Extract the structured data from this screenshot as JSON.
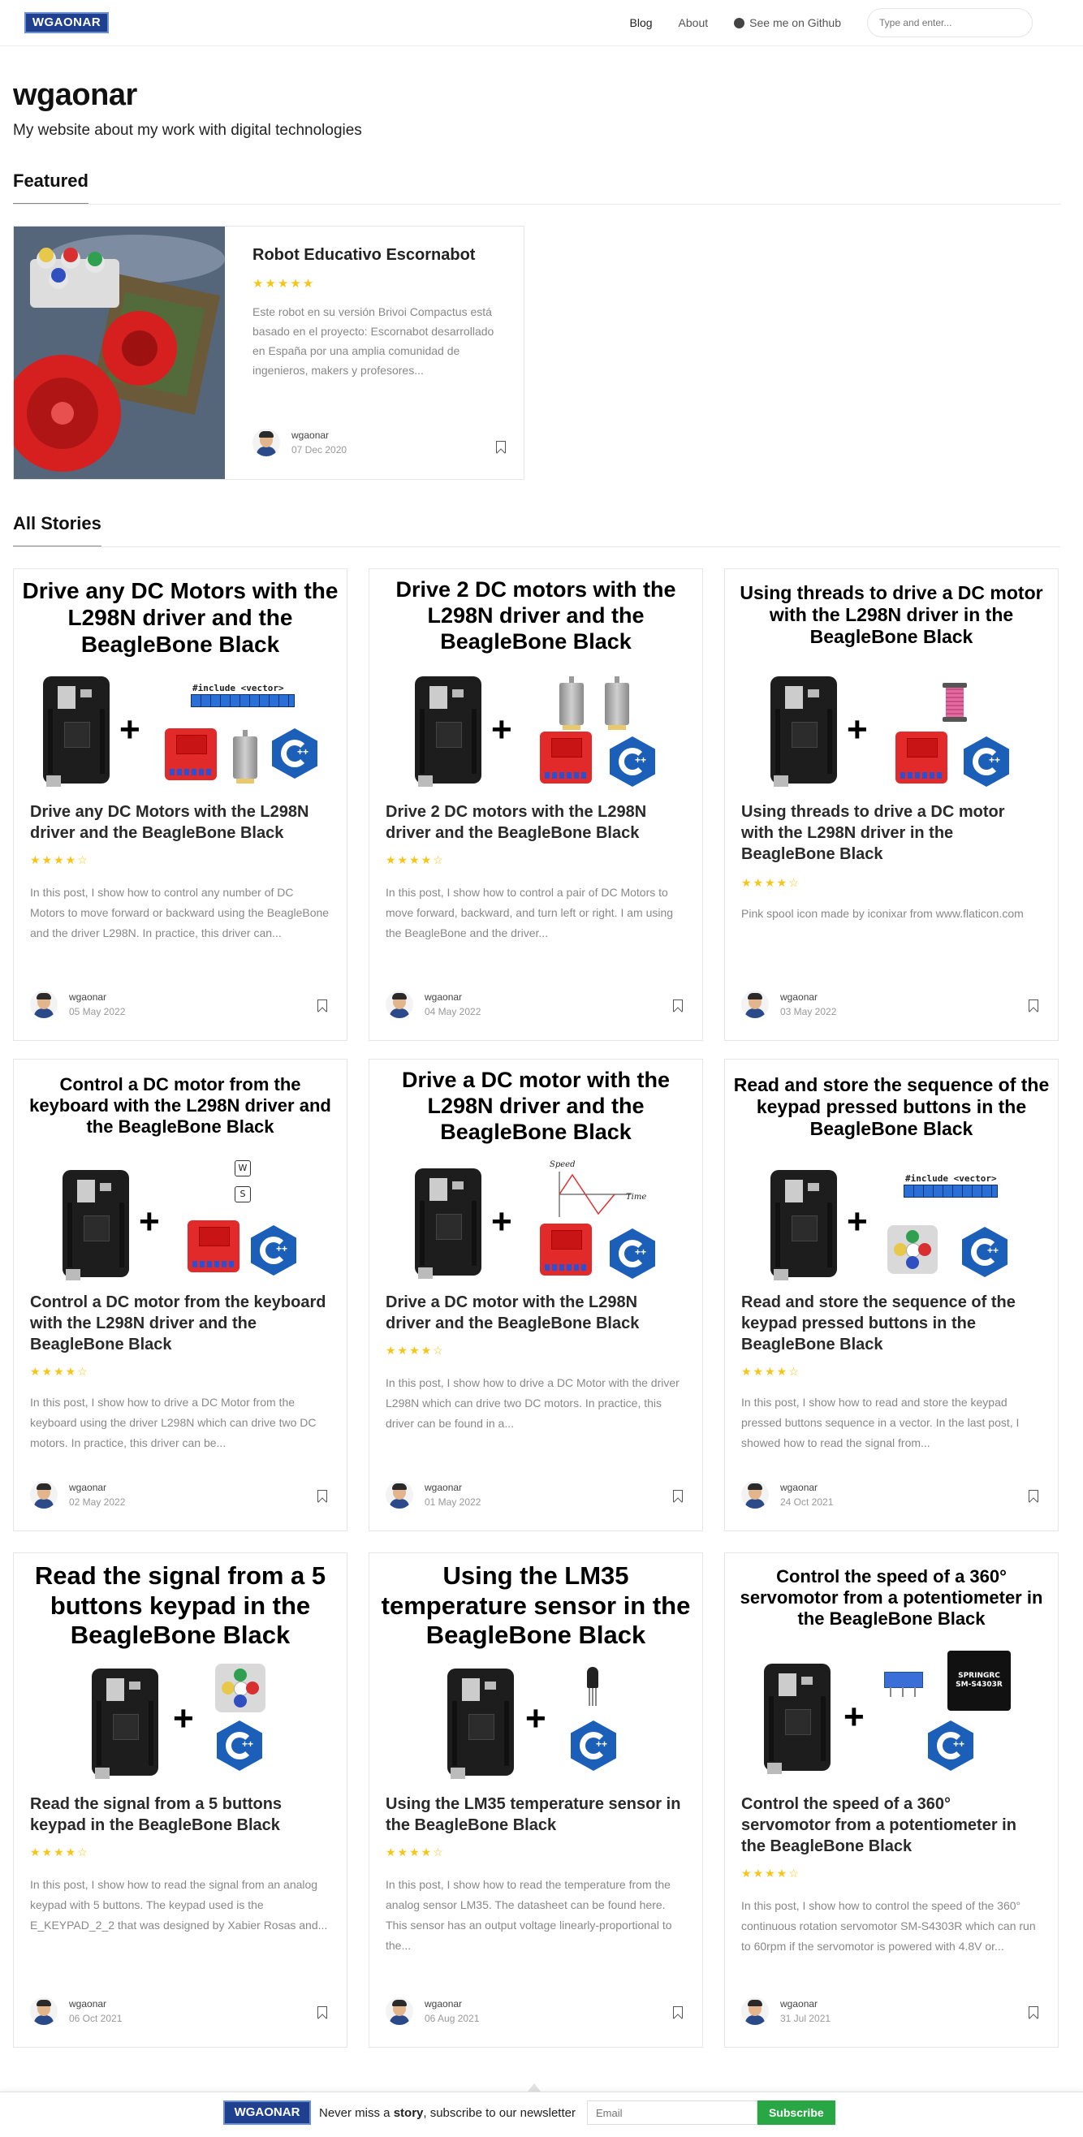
{
  "nav": {
    "logo": "WGAONAR",
    "blog": "Blog",
    "about": "About",
    "github": "See me on Github",
    "search_placeholder": "Type and enter..."
  },
  "header": {
    "title": "wgaonar",
    "description": "My website about my work with digital technologies"
  },
  "featured": {
    "heading": "Featured",
    "title": "Robot Educativo Escornabot",
    "stars": "★★★★★",
    "excerpt": "Este robot en su versión Brivoi Compactus está basado en el proyecto: Escornabot desarrollado en España por una amplia comunidad de ingenieros, makers y profesores...",
    "author": "wgaonar",
    "date": "07 Dec 2020"
  },
  "stories": {
    "heading": "All Stories",
    "cards": [
      {
        "thumb_title": "Drive any DC Motors with the L298N driver and the BeagleBone Black",
        "title": "Drive any DC Motors with the L298N driver and the BeagleBone Black",
        "stars": "★★★★☆",
        "excerpt": "In this post, I show how to control any number of DC Motors to move forward or backward using the BeagleBone and the driver L298N. In practice, this driver can...",
        "author": "wgaonar",
        "date": "05 May 2022",
        "vector_code": "#include <vector>"
      },
      {
        "thumb_title": "Drive 2 DC motors with the L298N driver and the BeagleBone Black",
        "title": "Drive 2 DC motors with the L298N driver and the BeagleBone Black",
        "stars": "★★★★☆",
        "excerpt": "In this post, I show how to control a pair of DC Motors to move forward, backward, and turn left or right. I am using the BeagleBone and the driver...",
        "author": "wgaonar",
        "date": "04 May 2022"
      },
      {
        "thumb_title": "Using threads to drive a DC motor with the L298N driver in the BeagleBone Black",
        "title": "Using threads to drive a DC motor with the L298N driver in the BeagleBone Black",
        "stars": "★★★★☆",
        "excerpt": "Pink spool icon made by iconixar from www.flaticon.com",
        "author": "wgaonar",
        "date": "03 May 2022"
      },
      {
        "thumb_title": "Control a DC motor from the keyboard with the L298N driver and the BeagleBone Black",
        "title": "Control a DC motor from the keyboard with the L298N driver and the BeagleBone Black",
        "stars": "★★★★☆",
        "excerpt": "In this post, I show how to drive a DC Motor from the keyboard using the driver L298N which can drive two DC motors. In practice, this driver can be...",
        "author": "wgaonar",
        "date": "02 May 2022",
        "key_w": "W",
        "key_s": "S"
      },
      {
        "thumb_title": "Drive a DC motor with the L298N driver and the BeagleBone Black",
        "title": "Drive a DC motor with the L298N driver and the BeagleBone Black",
        "stars": "★★★★☆",
        "excerpt": "In this post, I show how to drive a DC Motor with the driver L298N which can drive two DC motors. In practice, this driver can be found in a...",
        "author": "wgaonar",
        "date": "01 May 2022",
        "speed_label": "Speed",
        "time_label": "Time"
      },
      {
        "thumb_title": "Read and store the sequence of the keypad pressed buttons in the BeagleBone Black",
        "title": "Read and store the sequence of the keypad pressed buttons in the BeagleBone Black",
        "stars": "★★★★☆",
        "excerpt": "In this post, I show how to read and store the keypad pressed buttons sequence in a vector. In the last post, I showed how to read the signal from...",
        "author": "wgaonar",
        "date": "24 Oct 2021",
        "vector_code": "#include <vector>"
      },
      {
        "thumb_title": "Read the signal from a 5 buttons keypad in the BeagleBone Black",
        "title": "Read the signal from a 5 buttons keypad in the BeagleBone Black",
        "stars": "★★★★☆",
        "excerpt": "In this post, I show how to read the signal from an analog keypad with 5 buttons. The keypad used is the E_KEYPAD_2_2 that was designed by Xabier Rosas and...",
        "author": "wgaonar",
        "date": "06 Oct 2021"
      },
      {
        "thumb_title": "Using the LM35 temperature sensor in the BeagleBone Black",
        "title": "Using the LM35 temperature sensor in the BeagleBone Black",
        "stars": "★★★★☆",
        "excerpt": "In this post, I show how to read the temperature from the analog sensor LM35. The datasheet can be found here. This sensor has an output voltage linearly-proportional to the...",
        "author": "wgaonar",
        "date": "06 Aug 2021"
      },
      {
        "thumb_title": "Control the speed of a 360° servomotor from a potentiometer in the BeagleBone Black",
        "title": "Control the speed of a 360° servomotor from a potentiometer in the BeagleBone Black",
        "stars": "★★★★☆",
        "excerpt": "In this post, I show how to control the speed of the 360° continuous rotation servomotor SM-S4303R which can run to 60rpm if the servomotor is powered with 4.8V or...",
        "author": "wgaonar",
        "date": "31 Jul 2021",
        "servo_label": "SPRINGRC SM-S4303R"
      }
    ]
  },
  "newsletter": {
    "logo": "WGAONAR",
    "text_before": "Never miss a ",
    "text_bold": "story",
    "text_after": ", subscribe to our newsletter",
    "email_placeholder": "Email",
    "button": "Subscribe"
  },
  "colors": {
    "accent": "#29a745",
    "star": "#f5c518",
    "logo_bg": "#1f3f8f"
  }
}
